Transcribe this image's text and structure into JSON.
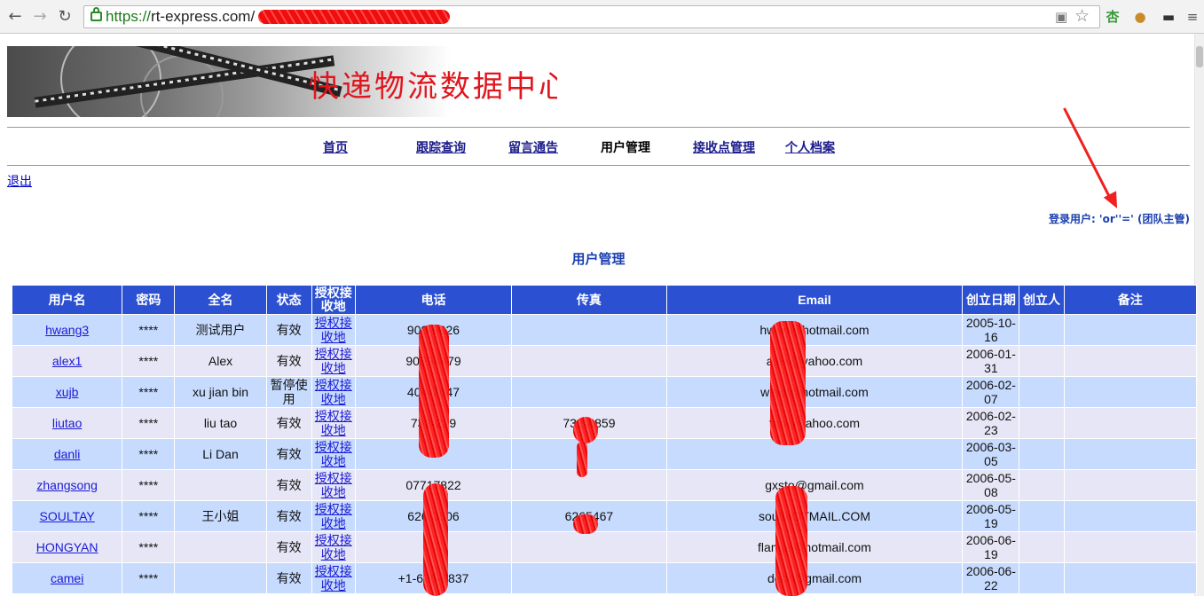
{
  "browser": {
    "url_scheme": "https://",
    "url_host": "rt-express.com",
    "url_redacted_suffix": "/",
    "icons": [
      "back-icon",
      "forward-icon",
      "reload-icon",
      "lock-icon",
      "translate-icon",
      "star-icon",
      "extension-apricot-icon",
      "cookie-icon",
      "mask-icon",
      "menu-icon"
    ]
  },
  "header": {
    "banner_title": "快递物流数据中心"
  },
  "nav": {
    "items": [
      {
        "label": "首页",
        "current": false
      },
      {
        "label": "跟踪查询",
        "current": false
      },
      {
        "label": "留言通告",
        "current": false
      },
      {
        "label": "用户管理",
        "current": true
      },
      {
        "label": "接收点管理",
        "current": false
      },
      {
        "label": "个人档案",
        "current": false
      }
    ]
  },
  "logout_label": "退出",
  "login_info": "登录用户: 'or''=' (团队主管)",
  "page_heading": "用户管理",
  "colors": {
    "header_bg": "#2b50d2",
    "row_odd": "#c7dbff",
    "row_even": "#e6e6f6",
    "accent_red": "#e0161e"
  },
  "table": {
    "columns": [
      "用户名",
      "密码",
      "全名",
      "状态",
      "授权接收地",
      "电话",
      "传真",
      "Email",
      "创立日期",
      "创立人",
      "备注"
    ],
    "rows": [
      {
        "username": "hwang3",
        "password": "****",
        "fullname": "测试用户",
        "status": "有效",
        "auth": "授权接收地",
        "phone": "909-9026",
        "fax": "",
        "email": "hwan@hotmail.com",
        "created": "2005-10-16",
        "creator": "",
        "note": ""
      },
      {
        "username": "alex1",
        "password": "****",
        "fullname": "Alex",
        "status": "有效",
        "auth": "授权接收地",
        "phone": "90994479",
        "fax": "",
        "email": "alex@yahoo.com",
        "created": "2006-01-31",
        "creator": "",
        "note": ""
      },
      {
        "username": "xujb",
        "password": "****",
        "fullname": "xu jian bin",
        "status": "暂停使用",
        "auth": "授权接收地",
        "phone": "404-7647",
        "fax": "",
        "email": "windl@hotmail.com",
        "created": "2006-02-07",
        "creator": "",
        "note": ""
      },
      {
        "username": "liutao",
        "password": "****",
        "fullname": "liu tao",
        "status": "有效",
        "auth": "授权接收地",
        "phone": "732-229",
        "fax": "732-4859",
        "email": "tao@yahoo.com",
        "created": "2006-02-23",
        "creator": "",
        "note": ""
      },
      {
        "username": "danli",
        "password": "****",
        "fullname": "Li Dan",
        "status": "有效",
        "auth": "授权接收地",
        "phone": "",
        "fax": "",
        "email": "",
        "created": "2006-03-05",
        "creator": "",
        "note": ""
      },
      {
        "username": "zhangsong",
        "password": "****",
        "fullname": "",
        "status": "有效",
        "auth": "授权接收地",
        "phone": "07717822",
        "fax": "",
        "email": "gxsto@gmail.com",
        "created": "2006-05-08",
        "creator": "",
        "note": ""
      },
      {
        "username": "SOULTAY",
        "password": "****",
        "fullname": "王小姐",
        "status": "有效",
        "auth": "授权接收地",
        "phone": "626 0506",
        "fax": "6265467",
        "email": "soultaOTMAIL.COM",
        "created": "2006-05-19",
        "creator": "",
        "note": ""
      },
      {
        "username": "HONGYAN",
        "password": "****",
        "fullname": "",
        "status": "有效",
        "auth": "授权接收地",
        "phone": "",
        "fax": "",
        "email": "flange@hotmail.com",
        "created": "2006-06-19",
        "creator": "",
        "note": ""
      },
      {
        "username": "camei",
        "password": "****",
        "fullname": "",
        "status": "有效",
        "auth": "授权接收地",
        "phone": "+1-626-6837",
        "fax": "",
        "email": "debr@gmail.com",
        "created": "2006-06-22",
        "creator": "",
        "note": ""
      }
    ]
  }
}
